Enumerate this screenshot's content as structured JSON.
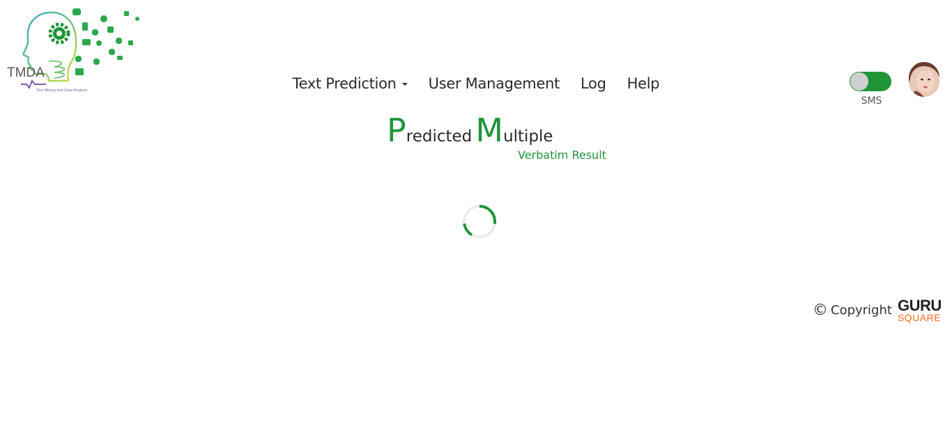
{
  "logo": {
    "name": "TMDA",
    "tagline": "Text Mining and Data Analysis"
  },
  "nav": {
    "items": [
      {
        "label": "Text Prediction",
        "has_dropdown": true
      },
      {
        "label": "User Management"
      },
      {
        "label": "Log"
      },
      {
        "label": "Help"
      }
    ]
  },
  "sms_toggle": {
    "label": "SMS",
    "on": true,
    "color": "#1f9438"
  },
  "title": {
    "p_initial": "P",
    "p_rest": "redicted",
    "m_initial": "M",
    "m_rest": "ultiple",
    "subtitle": "Verbatim Result"
  },
  "loading_spinner": {
    "icon": "spinner-icon",
    "color": "#1f9438"
  },
  "footer": {
    "copyright_symbol": "©",
    "copyright_label": "Copyright",
    "brand_top": "GURU",
    "brand_bottom": "SQUARE"
  },
  "colors": {
    "accent": "#1f9438",
    "brand_orange": "#f26a21"
  }
}
